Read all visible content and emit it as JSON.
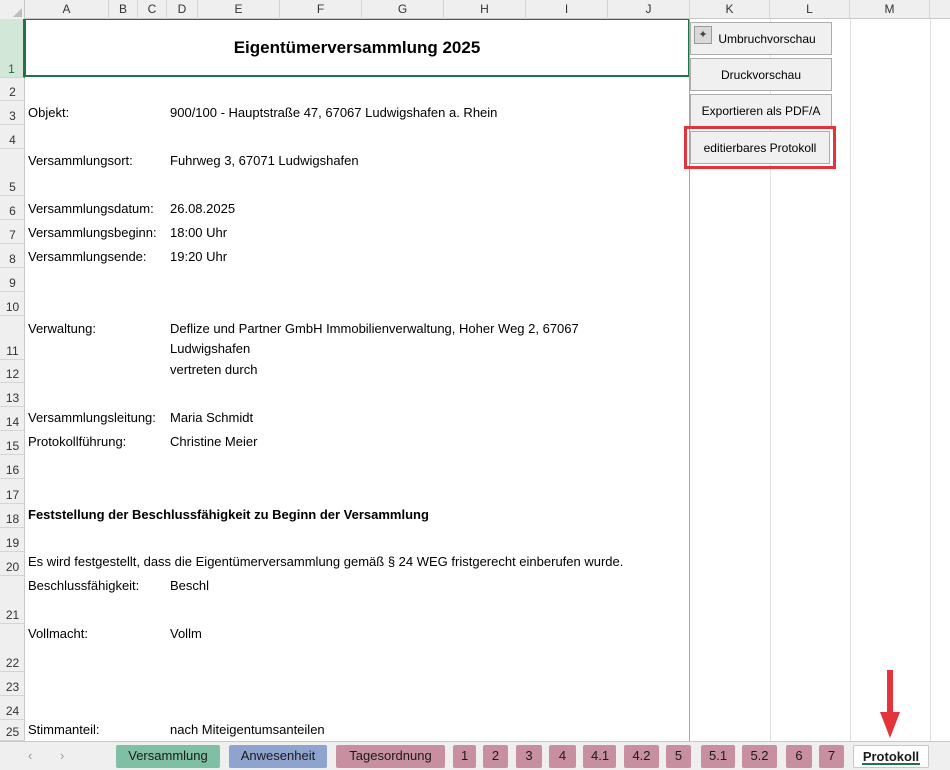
{
  "columns": [
    "A",
    "B",
    "C",
    "D",
    "E",
    "F",
    "G",
    "H",
    "I",
    "J",
    "K",
    "L",
    "M"
  ],
  "rows": [
    "1",
    "2",
    "3",
    "4",
    "5",
    "6",
    "7",
    "8",
    "9",
    "10",
    "11",
    "12",
    "13",
    "14",
    "15",
    "16",
    "17",
    "18",
    "19",
    "20",
    "21",
    "22",
    "23",
    "24",
    "25"
  ],
  "title": "Eigentümerversammlung 2025",
  "fields": {
    "objekt_label": "Objekt:",
    "objekt_value": "900/100 - Hauptstraße 47, 67067 Ludwigshafen a. Rhein",
    "ort_label": "Versammlungsort:",
    "ort_value": "Fuhrweg 3, 67071 Ludwigshafen",
    "datum_label": "Versammlungsdatum:",
    "datum_value": "26.08.2025",
    "beginn_label": "Versammlungsbeginn:",
    "beginn_value": "18:00 Uhr",
    "ende_label": "Versammlungsende:",
    "ende_value": "19:20 Uhr",
    "verwaltung_label": "Verwaltung:",
    "verwaltung_value_1": "Deflize und Partner GmbH Immobilienverwaltung, Hoher Weg 2, 67067",
    "verwaltung_value_2": "Ludwigshafen",
    "verwaltung_value_3": "vertreten durch",
    "leitung_label": "Versammlungsleitung:",
    "leitung_value": "Maria Schmidt",
    "protokoll_label": "Protokollführung:",
    "protokoll_value": "Christine Meier",
    "section_heading": "Feststellung der Beschlussfähigkeit zu Beginn der Versammlung",
    "statement": "Es wird festgestellt, dass die Eigentümerversammlung gemäß § 24 WEG fristgerecht einberufen wurde.",
    "beschluss_label": "Beschlussfähigkeit:",
    "beschluss_value": "Beschl",
    "vollmacht_label": "Vollmacht:",
    "vollmacht_value": "Vollm",
    "stimmanteil_label": "Stimmanteil:",
    "stimmanteil_value": "nach Miteigentumsanteilen"
  },
  "buttons": {
    "umbruch": "Umbruchvorschau",
    "druck": "Druckvorschau",
    "export": "Exportieren als PDF/A",
    "editierbar": "editierbares Protokoll"
  },
  "tabs": [
    {
      "label": "Versammlung",
      "color": "#7fbfa3"
    },
    {
      "label": "Anwesenheit",
      "color": "#8fa3cf"
    },
    {
      "label": "Tagesordnung",
      "color": "#c88fa1"
    },
    {
      "label": "1",
      "color": "#c88fa1"
    },
    {
      "label": "2",
      "color": "#c88fa1"
    },
    {
      "label": "3",
      "color": "#c88fa1"
    },
    {
      "label": "4",
      "color": "#c88fa1"
    },
    {
      "label": "4.1",
      "color": "#c88fa1"
    },
    {
      "label": "4.2",
      "color": "#c88fa1"
    },
    {
      "label": "5",
      "color": "#c88fa1"
    },
    {
      "label": "5.1",
      "color": "#c88fa1"
    },
    {
      "label": "5.2",
      "color": "#c88fa1"
    },
    {
      "label": "6",
      "color": "#c88fa1"
    },
    {
      "label": "7",
      "color": "#c88fa1"
    },
    {
      "label": "Protokoll",
      "color": "#ffffff",
      "active": true
    }
  ],
  "nav": {
    "prev": "‹",
    "next": "›"
  },
  "colors": {
    "accent": "#217346",
    "highlight": "#e4343b",
    "arrow": "#e4343b"
  }
}
